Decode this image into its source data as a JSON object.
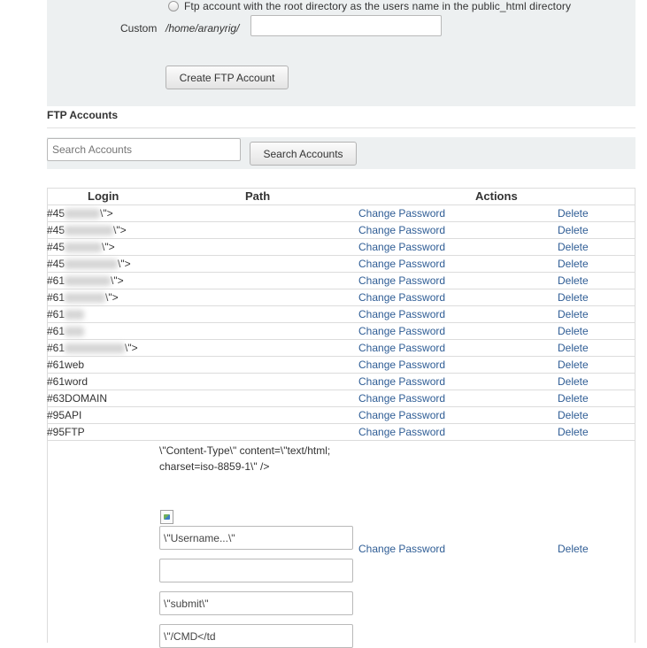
{
  "create_form": {
    "radio_label": "Ftp account with the root directory as the users name in the public_html directory",
    "custom_label": "Custom",
    "custom_path": "/home/aranyrig/",
    "custom_value": "",
    "create_button": "Create FTP Account"
  },
  "accounts": {
    "title": "FTP Accounts",
    "search_placeholder": "Search Accounts",
    "search_button": "Search Accounts",
    "headers": {
      "login": "Login",
      "path": "Path",
      "actions": "Actions"
    },
    "rows": [
      {
        "prefix": "#45",
        "suffix": "\\\">"
      },
      {
        "prefix": "#45",
        "suffix": "\\\">"
      },
      {
        "prefix": "#45",
        "suffix": "\\\">"
      },
      {
        "prefix": "#45",
        "suffix": "\\\">"
      },
      {
        "prefix": "#61",
        "suffix": "\\\">"
      },
      {
        "prefix": "#61",
        "suffix": "\\\">"
      },
      {
        "prefix": "#61",
        "suffix": ""
      },
      {
        "prefix": "#61",
        "suffix": ""
      },
      {
        "prefix": "#61",
        "suffix": "\\\">"
      },
      {
        "prefix": "#61web",
        "suffix": ""
      },
      {
        "prefix": "#61word",
        "suffix": ""
      },
      {
        "prefix": "#63DOMAIN",
        "suffix": ""
      },
      {
        "prefix": "#95API",
        "suffix": ""
      },
      {
        "prefix": "#95FTP",
        "suffix": ""
      }
    ],
    "change_password": "Change Password",
    "delete": "Delete",
    "injected": {
      "meta_text": "\\\"Content-Type\\\" content=\\\"text/html; charset=iso-8859-1\\\" />",
      "username_value": "\\\"Username...\\\"",
      "empty_value": "",
      "submit_value": "\\\"submit\\\"",
      "cmd_value": "\\\"/CMD</td"
    }
  }
}
